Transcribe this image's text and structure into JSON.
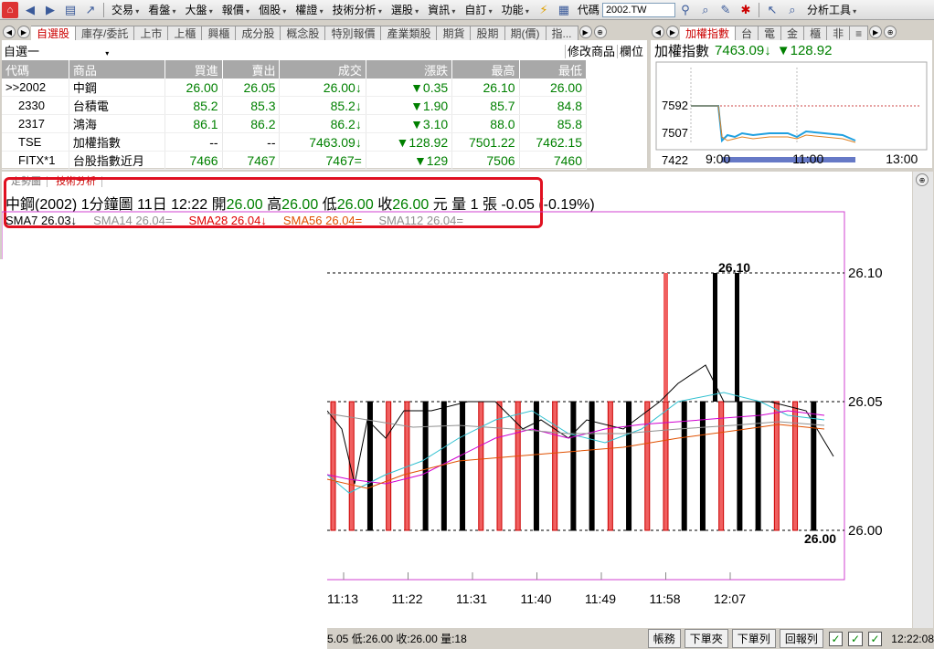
{
  "menubar": {
    "items": [
      "交易",
      "看盤",
      "大盤",
      "報價",
      "個股",
      "權證",
      "技術分析",
      "選股",
      "資訊",
      "自訂",
      "功能"
    ],
    "code_label": "代碼",
    "code_value": "2002.TW",
    "analysis_tool": "分析工具"
  },
  "quote_tabs": [
    "自選股",
    "庫存/委託",
    "上市",
    "上櫃",
    "興櫃",
    "成分股",
    "概念股",
    "特別報價",
    "產業類股",
    "期貨",
    "股期",
    "期(價)",
    "指..."
  ],
  "index_tabs": [
    "加權指數",
    "台",
    "電",
    "金",
    "櫃",
    "非",
    "≡"
  ],
  "watchlist": {
    "group_name": "自選一",
    "edit_label": "修改商品",
    "column_label": "欄位",
    "headers": [
      "代碼",
      "商品",
      "買進",
      "賣出",
      "成交",
      "漲跌",
      "最高",
      "最低"
    ],
    "rows": [
      {
        "code": ">>2002",
        "name": "中鋼",
        "bid": "26.00",
        "ask": "26.05",
        "last": "26.00↓",
        "change": "▼0.35",
        "high": "26.10",
        "low": "26.00"
      },
      {
        "code": "2330",
        "name": "台積電",
        "bid": "85.2",
        "ask": "85.3",
        "last": "85.2↓",
        "change": "▼1.90",
        "high": "85.7",
        "low": "84.8"
      },
      {
        "code": "2317",
        "name": "鴻海",
        "bid": "86.1",
        "ask": "86.2",
        "last": "86.2↓",
        "change": "▼3.10",
        "high": "88.0",
        "low": "85.8"
      },
      {
        "code": "TSE",
        "name": "加權指數",
        "bid": "--",
        "ask": "--",
        "last": "7463.09↓",
        "change": "▼128.92",
        "high": "7501.22",
        "low": "7462.15"
      },
      {
        "code": "FITX*1",
        "name": "台股指數近月",
        "bid": "7466",
        "ask": "7467",
        "last": "7467=",
        "change": "▼129",
        "high": "7506",
        "low": "7460"
      }
    ]
  },
  "index_panel": {
    "name": "加權指數",
    "value": "7463.09↓",
    "change": "▼128.92",
    "y_labels": [
      "7592",
      "7507",
      "7422"
    ],
    "x_labels": [
      "9:00",
      "11:00",
      "13:00"
    ]
  },
  "chart_tabs": [
    "走勢圖",
    "技術分析"
  ],
  "info_line": {
    "stock": "中鋼(2002)",
    "period": "1分鐘圖",
    "datetime": "11日 12:22",
    "open_label": "開",
    "open": "26.00",
    "high_label": "高",
    "high": "26.00",
    "low_label": "低",
    "low": "26.00",
    "close_label": "收",
    "close": "26.00",
    "unit": "元",
    "volume": "量 1 張",
    "change": "-0.05 (-0.19%)"
  },
  "ma_line": [
    {
      "text": "SMA7 26.03↓",
      "color": "#000000"
    },
    {
      "text": "SMA14 26.04=",
      "color": "#909090"
    },
    {
      "text": "SMA28 26.04↓",
      "color": "#e00000"
    },
    {
      "text": "SMA56 26.04=",
      "color": "#e05000"
    },
    {
      "text": "SMA112 26.04=",
      "color": "#909090"
    }
  ],
  "status_bar": {
    "quote_text": "5.05 低:26.00 收:26.00 量:18",
    "buttons": [
      "帳務",
      "下單夾",
      "下單列",
      "回報列"
    ],
    "time": "12:22:08"
  },
  "chart_data": {
    "type": "bar",
    "x_tick_labels": [
      "11:13",
      "11:22",
      "11:31",
      "11:40",
      "11:49",
      "11:58",
      "12:07"
    ],
    "y_tick_labels": [
      "26.10",
      "26.05",
      "26.00"
    ],
    "ylim": [
      26.0,
      26.1
    ],
    "annotations": [
      "26.10",
      "26.00"
    ],
    "candle_bars": [
      {
        "x": 0,
        "color": "red"
      },
      {
        "x": 1,
        "color": "red"
      },
      {
        "x": 2,
        "color": "black"
      },
      {
        "x": 3,
        "color": "red"
      },
      {
        "x": 4,
        "color": "red"
      },
      {
        "x": 5,
        "color": "black"
      },
      {
        "x": 6,
        "color": "black"
      },
      {
        "x": 7,
        "color": "black"
      },
      {
        "x": 8,
        "color": "red"
      },
      {
        "x": 9,
        "color": "red"
      },
      {
        "x": 10,
        "color": "red"
      },
      {
        "x": 11,
        "color": "black"
      },
      {
        "x": 12,
        "color": "red"
      },
      {
        "x": 13,
        "color": "black"
      },
      {
        "x": 14,
        "color": "black"
      },
      {
        "x": 15,
        "color": "red"
      },
      {
        "x": 16,
        "color": "black"
      },
      {
        "x": 17,
        "color": "red"
      },
      {
        "x": 18,
        "color": "red"
      },
      {
        "x": 19,
        "color": "black"
      },
      {
        "x": 20,
        "color": "black"
      },
      {
        "x": 21,
        "color": "red"
      },
      {
        "x": 22,
        "color": "black"
      },
      {
        "x": 23,
        "color": "black"
      },
      {
        "x": 24,
        "color": "red"
      },
      {
        "x": 25,
        "color": "red"
      },
      {
        "x": 26,
        "color": "black"
      }
    ]
  }
}
